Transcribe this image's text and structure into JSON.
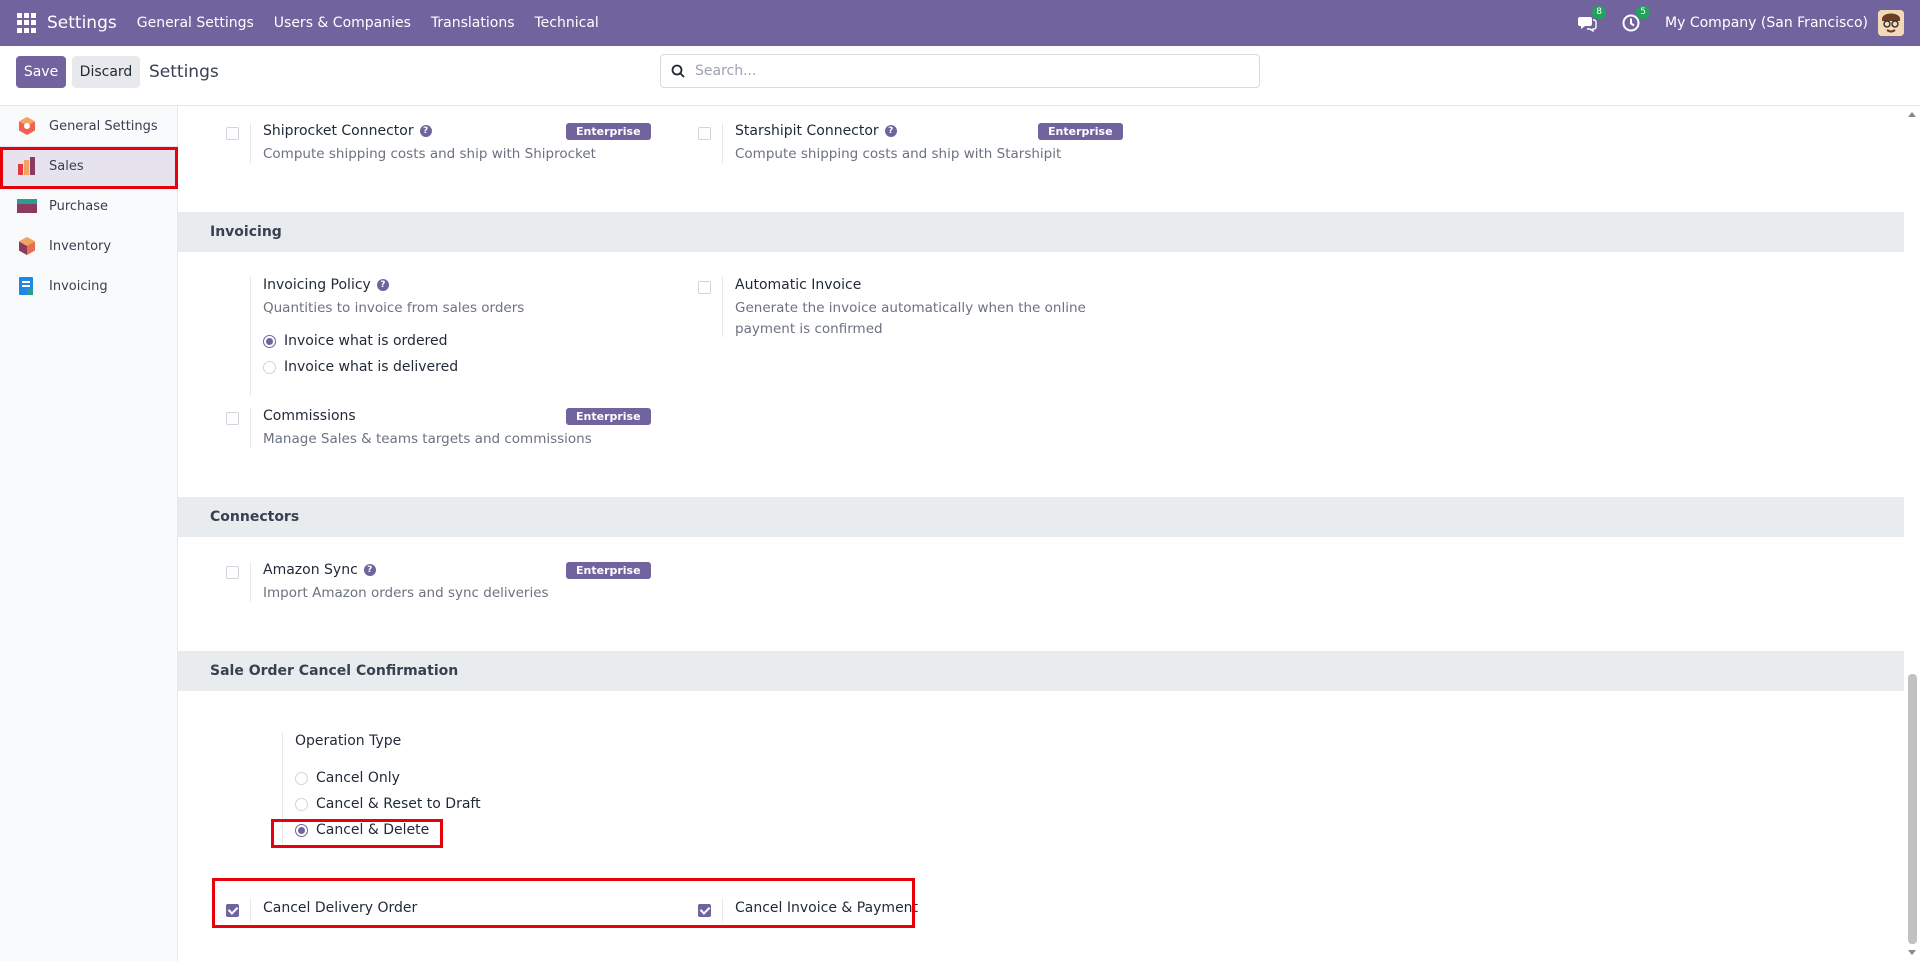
{
  "navbar": {
    "brand": "Settings",
    "menu": [
      "General Settings",
      "Users & Companies",
      "Translations",
      "Technical"
    ],
    "messages_count": "8",
    "activities_count": "5",
    "company": "My Company (San Francisco)"
  },
  "control_panel": {
    "save_label": "Save",
    "discard_label": "Discard",
    "title": "Settings",
    "search_placeholder": "Search..."
  },
  "sidebar": {
    "items": [
      {
        "label": "General Settings",
        "icon": "general-settings-icon",
        "color": "#f06050"
      },
      {
        "label": "Sales",
        "icon": "sales-icon",
        "color": "#f4a261",
        "active": true
      },
      {
        "label": "Purchase",
        "icon": "purchase-icon",
        "color": "#8b3a62"
      },
      {
        "label": "Inventory",
        "icon": "inventory-icon",
        "color": "#e76f51"
      },
      {
        "label": "Invoicing",
        "icon": "invoicing-icon",
        "color": "#1e88e5"
      }
    ]
  },
  "shipping": {
    "shiprocket": {
      "label": "Shiprocket Connector",
      "desc": "Compute shipping costs and ship with Shiprocket",
      "badge": "Enterprise"
    },
    "starshipit": {
      "label": "Starshipit Connector",
      "desc": "Compute shipping costs and ship with Starshipit",
      "badge": "Enterprise"
    }
  },
  "invoicing": {
    "heading": "Invoicing",
    "policy": {
      "label": "Invoicing Policy",
      "desc": "Quantities to invoice from sales orders",
      "options": [
        "Invoice what is ordered",
        "Invoice what is delivered"
      ],
      "selected": "Invoice what is ordered"
    },
    "auto_invoice": {
      "label": "Automatic Invoice",
      "desc": "Generate the invoice automatically when the online payment is confirmed"
    },
    "commissions": {
      "label": "Commissions",
      "desc": "Manage Sales & teams targets and commissions",
      "badge": "Enterprise"
    }
  },
  "connectors": {
    "heading": "Connectors",
    "amazon": {
      "label": "Amazon Sync",
      "desc": "Import Amazon orders and sync deliveries",
      "badge": "Enterprise"
    }
  },
  "cancel_confirmation": {
    "heading": "Sale Order Cancel Confirmation",
    "operation_type_label": "Operation Type",
    "options": [
      "Cancel Only",
      "Cancel & Reset to Draft",
      "Cancel & Delete"
    ],
    "selected": "Cancel & Delete",
    "cancel_delivery": {
      "label": "Cancel Delivery Order",
      "checked": true
    },
    "cancel_invoice": {
      "label": "Cancel Invoice & Payment",
      "checked": true
    }
  },
  "colors": {
    "brand": "#71639e",
    "highlight": "#e8000b"
  }
}
